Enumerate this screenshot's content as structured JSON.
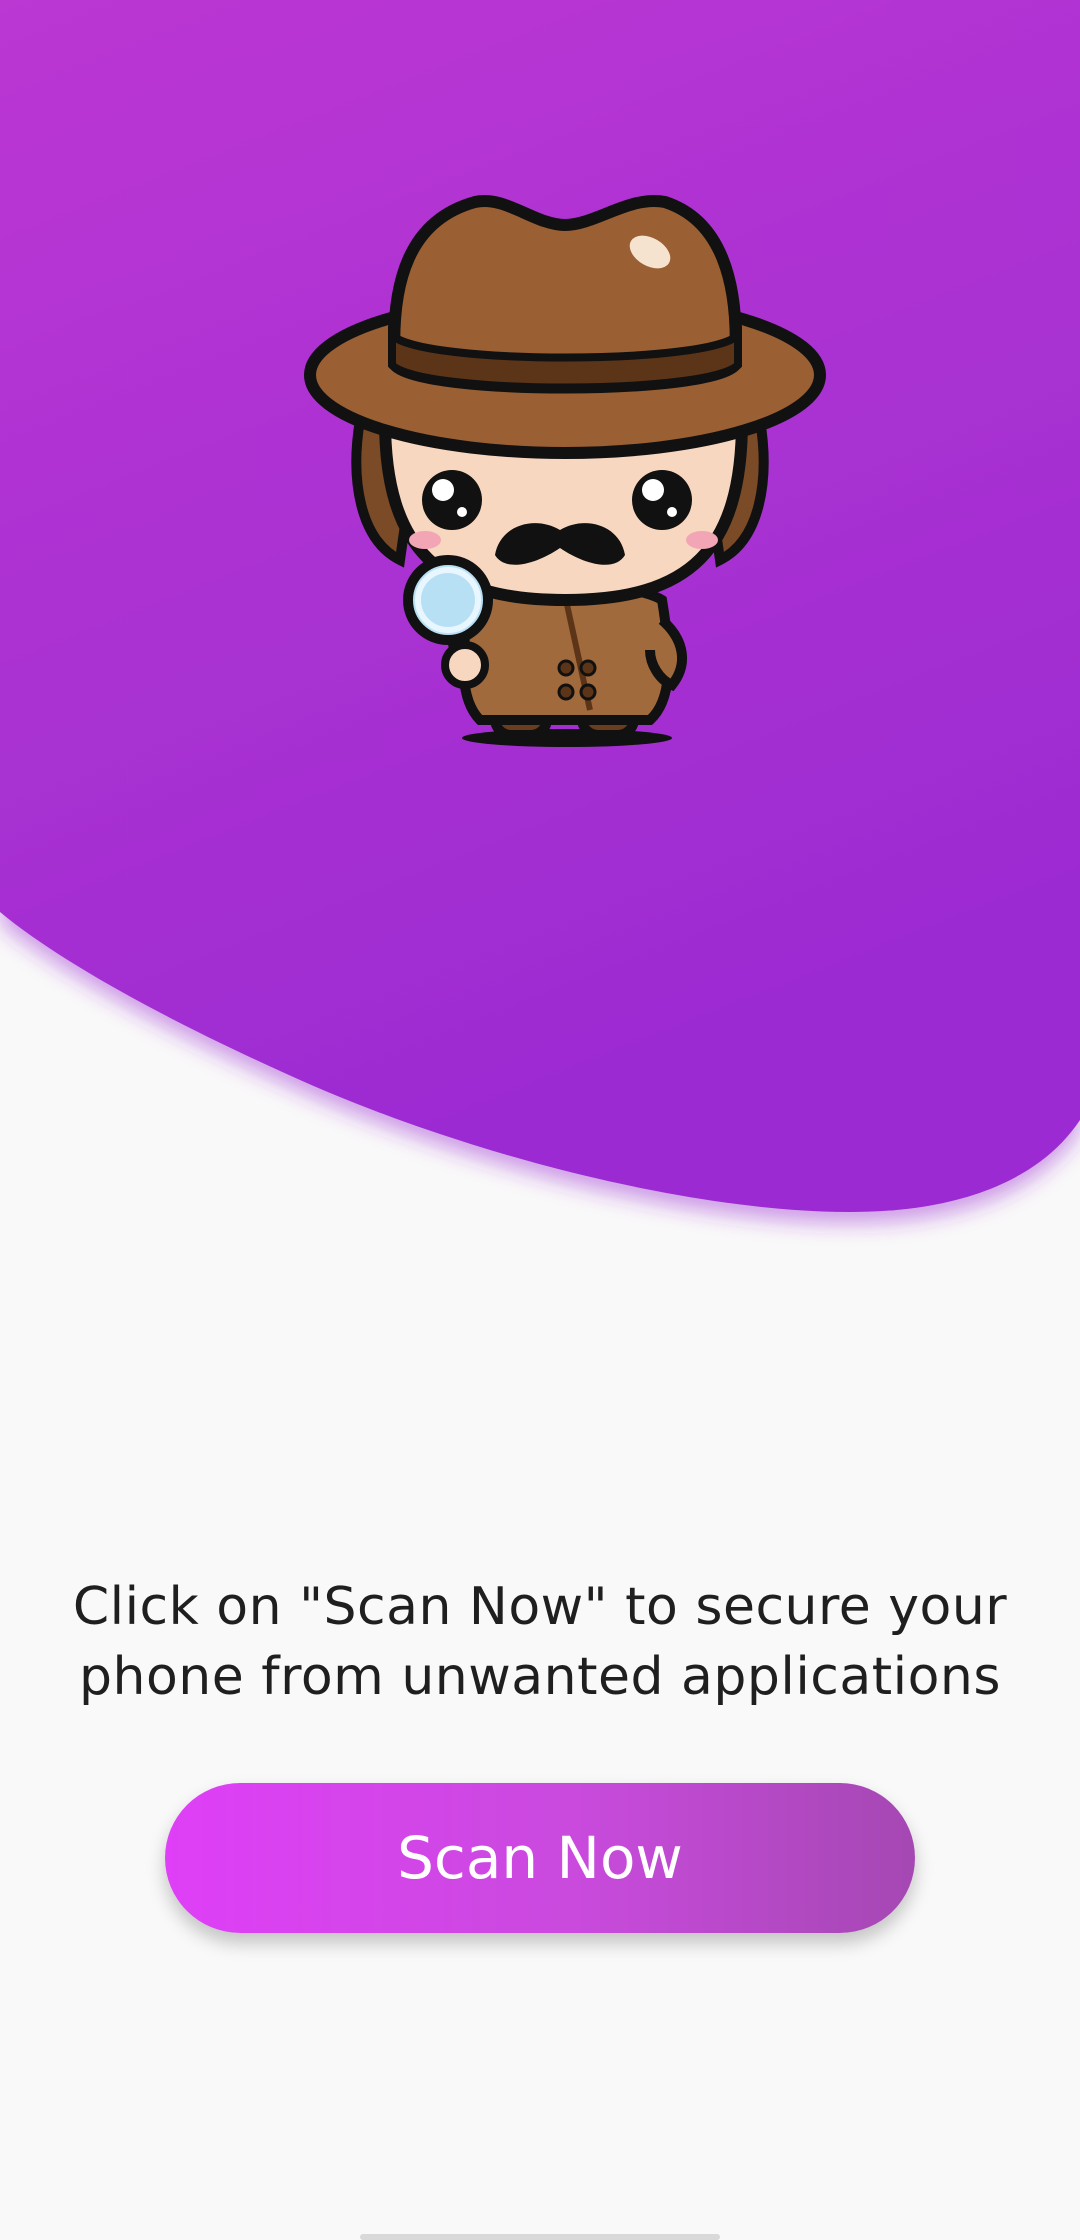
{
  "theme": {
    "gradient_top": "#bb37d3",
    "gradient_bottom": "#9b2bd2",
    "button_start": "#df3ff7",
    "button_end": "#a548b3",
    "background": "#f9f9f9",
    "text_color": "#1f1f1f"
  },
  "hero": {
    "mascot_icon": "detective-mascot-icon"
  },
  "main": {
    "prompt_line1": "Click on \"Scan Now\" to secure your",
    "prompt_line2": "phone from unwanted applications",
    "scan_button_label": "Scan Now"
  }
}
